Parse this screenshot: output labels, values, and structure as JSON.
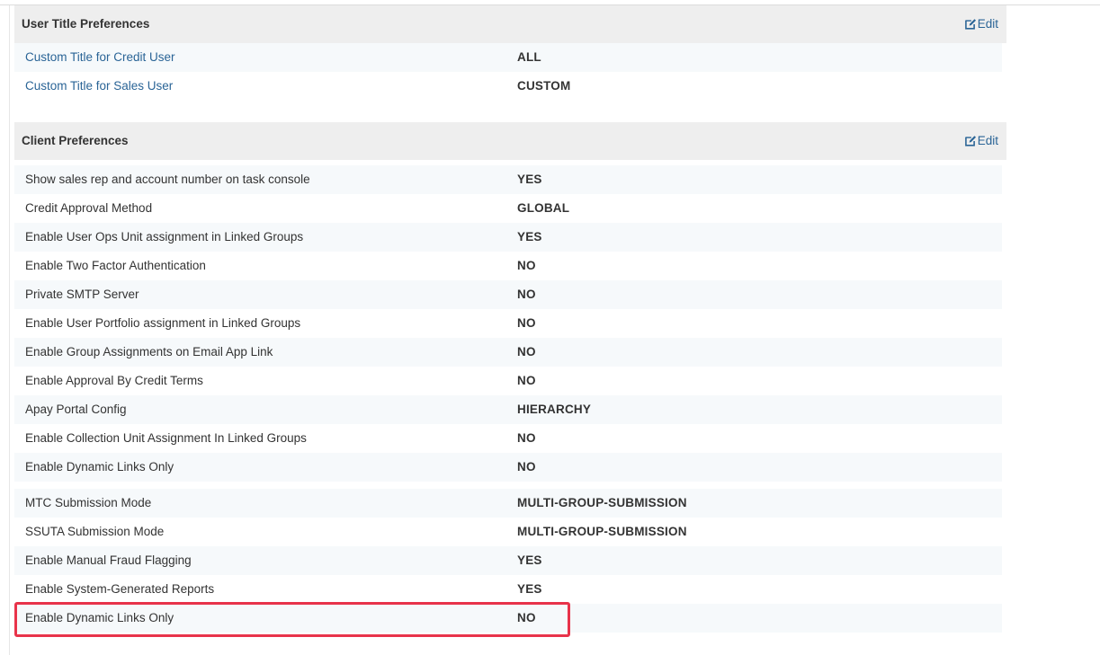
{
  "user_title_preferences": {
    "title": "User Title Preferences",
    "edit_label": "Edit",
    "rows": [
      {
        "label": "Custom Title for Credit User",
        "value": "ALL"
      },
      {
        "label": "Custom Title for Sales User",
        "value": "CUSTOM"
      }
    ]
  },
  "client_preferences": {
    "title": "Client Preferences",
    "edit_label": "Edit",
    "rows": [
      {
        "label": "Show sales rep and account number on task console",
        "value": "YES"
      },
      {
        "label": "Credit Approval Method",
        "value": "GLOBAL"
      },
      {
        "label": "Enable User Ops Unit assignment in Linked Groups",
        "value": "YES"
      },
      {
        "label": "Enable Two Factor Authentication",
        "value": "NO"
      },
      {
        "label": "Private SMTP Server",
        "value": "NO"
      },
      {
        "label": "Enable User Portfolio assignment in Linked Groups",
        "value": "NO"
      },
      {
        "label": "Enable Group Assignments on Email App Link",
        "value": "NO"
      },
      {
        "label": "Enable Approval By Credit Terms",
        "value": "NO"
      },
      {
        "label": "Apay Portal Config",
        "value": "HIERARCHY"
      },
      {
        "label": "Enable Collection Unit Assignment In Linked Groups",
        "value": "NO"
      },
      {
        "label": "Enable Dynamic Links Only",
        "value": "NO"
      },
      {
        "label": "MTC Submission Mode",
        "value": "MULTI-GROUP-SUBMISSION"
      },
      {
        "label": "SSUTA Submission Mode",
        "value": "MULTI-GROUP-SUBMISSION"
      },
      {
        "label": "Enable Manual Fraud Flagging",
        "value": "YES"
      },
      {
        "label": "Enable System-Generated Reports",
        "value": "YES"
      },
      {
        "label": "Enable Dynamic Links Only",
        "value": "NO"
      }
    ]
  },
  "colors": {
    "link": "#2a6496",
    "header_bg": "#eeeeee",
    "stripe_bg": "#f6f9fb",
    "highlight": "#e8334a"
  },
  "icons": {
    "edit": "edit-icon"
  }
}
